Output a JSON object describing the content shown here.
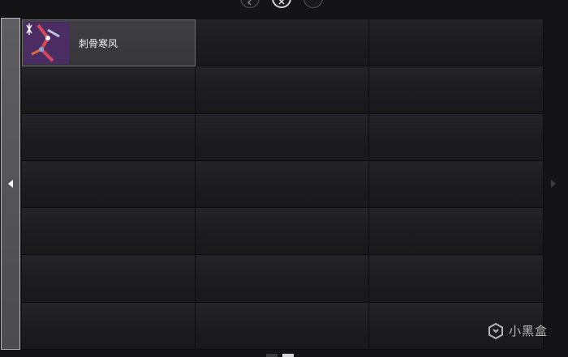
{
  "top_tabs": [
    {
      "icon": "back-circle-icon",
      "active": false
    },
    {
      "icon": "x-circle-icon",
      "active": true
    },
    {
      "icon": "blank-circle-icon",
      "active": false
    }
  ],
  "inventory": {
    "items": [
      {
        "name": "刺骨寒风",
        "icon": "weapon-thumbnail"
      }
    ]
  },
  "watermark": {
    "text": "小黑盒"
  },
  "colors": {
    "background": "#141417",
    "cell": "#1f1f23",
    "selected_cell": "#3b3b40",
    "thumb": "#6b3a80"
  }
}
